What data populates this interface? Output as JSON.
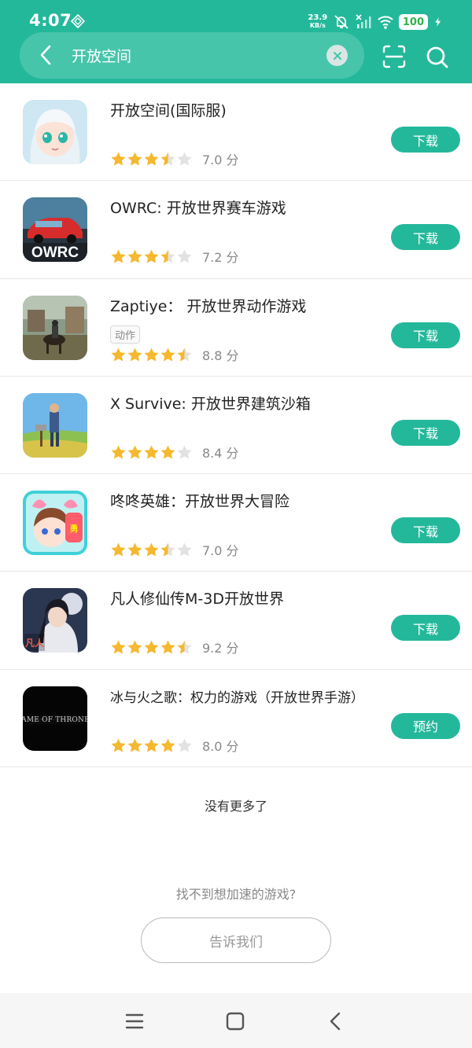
{
  "status_bar": {
    "time": "4:07",
    "net_speed_value": "23.9",
    "net_speed_unit": "KB/s",
    "battery": "100"
  },
  "search": {
    "query": "开放空间"
  },
  "colors": {
    "accent": "#24b89b",
    "star": "#f5b82e",
    "star_empty": "#e2e2e2"
  },
  "apps": [
    {
      "title": "开放空间(国际服)",
      "tag": "",
      "stars": 3.5,
      "score": "7.0 分",
      "action": "下载"
    },
    {
      "title": "OWRC: 开放世界赛车游戏",
      "tag": "",
      "stars": 3.5,
      "score": "7.2 分",
      "action": "下载"
    },
    {
      "title": "Zaptiye： 开放世界动作游戏",
      "tag": "动作",
      "stars": 4.5,
      "score": "8.8 分",
      "action": "下载"
    },
    {
      "title": "X Survive: 开放世界建筑沙箱",
      "tag": "",
      "stars": 4,
      "score": "8.4 分",
      "action": "下载"
    },
    {
      "title": "咚咚英雄：开放世界大冒险",
      "tag": "",
      "stars": 3.5,
      "score": "7.0 分",
      "action": "下载"
    },
    {
      "title": "凡人修仙传M-3D开放世界",
      "tag": "",
      "stars": 4.5,
      "score": "9.2 分",
      "action": "下载"
    },
    {
      "title": "冰与火之歌：权力的游戏（开放世界手游）",
      "tag": "",
      "stars": 4,
      "score": "8.0 分",
      "action": "预约"
    }
  ],
  "footer": {
    "no_more": "没有更多了",
    "cant_find": "找不到想加速的游戏?",
    "tell_us": "告诉我们"
  },
  "icons": [
    "back-arrow-icon",
    "clear-icon",
    "scan-icon",
    "search-icon",
    "star-icon",
    "menu-icon",
    "home-icon",
    "back-icon"
  ]
}
